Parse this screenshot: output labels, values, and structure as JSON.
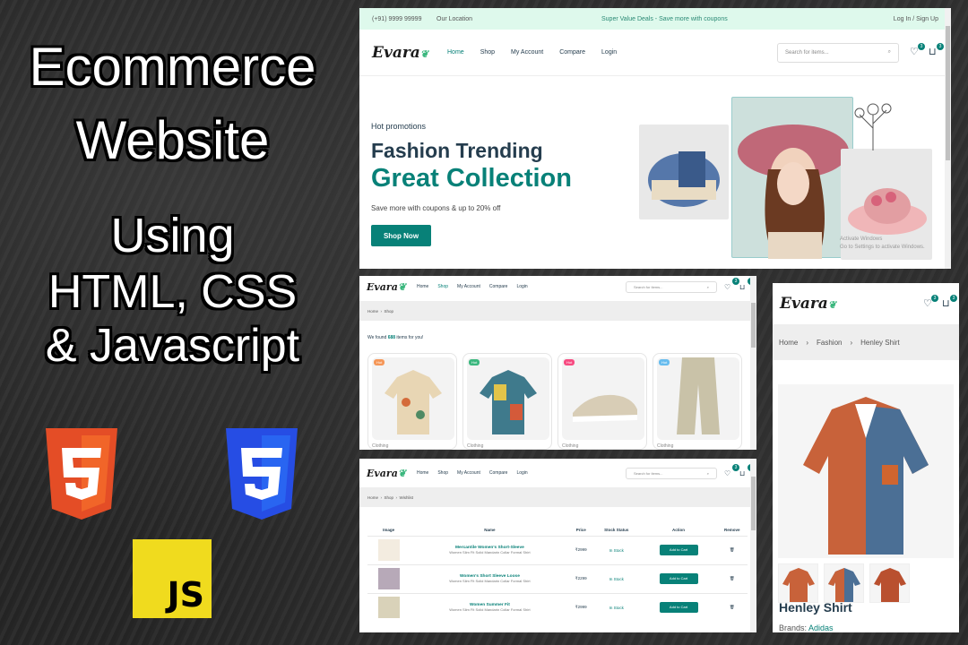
{
  "title": {
    "line1": "Ecommerce",
    "line2": "Website",
    "line3": "Using",
    "line4": "HTML, CSS",
    "line5": "& Javascript"
  },
  "logos": [
    "html5-logo",
    "css3-logo",
    "js-logo"
  ],
  "js_label": "JS",
  "site": {
    "brand": "Evara",
    "topbar": {
      "phone": "(+91) 9999 99999",
      "location": "Our Location",
      "promo": "Super Value Deals - Save more with coupons",
      "auth": "Log In / Sign Up"
    },
    "nav": [
      "Home",
      "Shop",
      "My Account",
      "Compare",
      "Login"
    ],
    "search_placeholder": "Search for items...",
    "badges": {
      "wishlist": "3",
      "cart": "3"
    },
    "hero": {
      "kicker": "Hot promotions",
      "line1": "Fashion Trending",
      "line2": "Great Collection",
      "sub": "Save more with coupons & up to 20% off",
      "cta": "Shop Now"
    },
    "watermark1": "Activate Windows",
    "watermark2": "Go to Settings to activate Windows."
  },
  "shop": {
    "breadcrumb": [
      "Home",
      "Shop"
    ],
    "found_prefix": "We found ",
    "found_count": "688",
    "found_suffix": " items for you!",
    "products": [
      {
        "tag": "Hot",
        "category": "Clothing"
      },
      {
        "tag": "Hot",
        "category": "Clothing"
      },
      {
        "tag": "Hot",
        "category": "Clothing"
      },
      {
        "tag": "Hot",
        "category": "Clothing"
      }
    ]
  },
  "wishlist": {
    "breadcrumb": [
      "Home",
      "Shop",
      "Wishlist"
    ],
    "columns": [
      "Image",
      "Name",
      "Price",
      "Stock Status",
      "Action",
      "Remove"
    ],
    "rows": [
      {
        "name": "Mercantile Women's Short-Sleeve",
        "desc": "Women Slim Fit Solid Mandarin Collar Formal Shirt",
        "price": "₹2999",
        "stock": "In Stock",
        "action": "Add to Cart"
      },
      {
        "name": "Women's Short Sleeve Loose",
        "desc": "Women Slim Fit Solid Mandarin Collar Formal Shirt",
        "price": "₹2299",
        "stock": "In Stock",
        "action": "Add to Cart"
      },
      {
        "name": "Women Summer Fit",
        "desc": "Women Slim Fit Solid Mandarin Collar Formal Shirt",
        "price": "₹2999",
        "stock": "In Stock",
        "action": "Add to Cart"
      }
    ]
  },
  "product": {
    "breadcrumb": [
      "Home",
      "Fashion",
      "Henley Shirt"
    ],
    "title": "Henley Shirt",
    "brand_label": "Brands: ",
    "brand_value": "Adidas"
  },
  "colors": {
    "accent": "#088178",
    "topbar": "#def9ec",
    "js_yellow": "#f0db1e",
    "html_orange": "#e44d26",
    "css_blue": "#264de4"
  }
}
